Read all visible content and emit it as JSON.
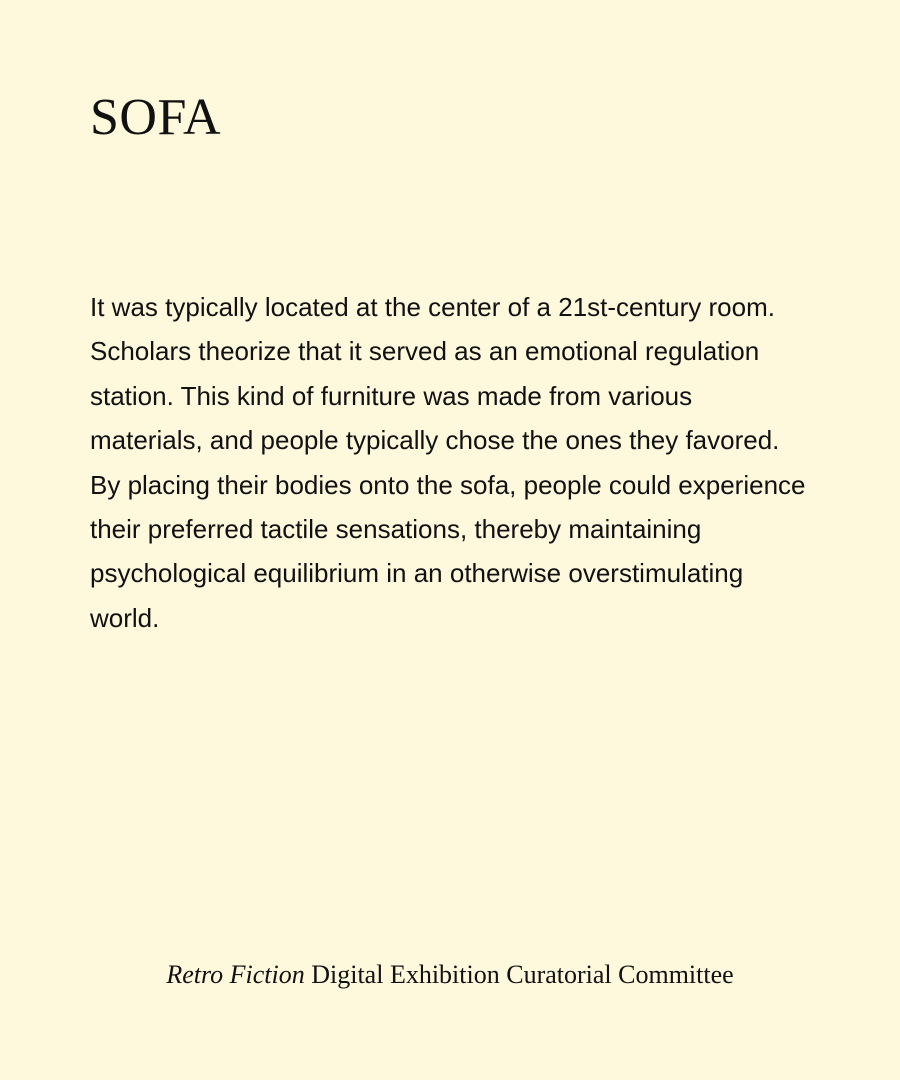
{
  "title": "SOFA",
  "description": "It was typically located at the center of a 21st-century room. Scholars theorize that it served as an emotional regulation station. This kind of furniture was made from various materials, and people typically chose the ones they favored. By placing their bodies onto the sofa, people could experience their preferred tactile sensations, thereby maintaining psychological equilibrium in an otherwise overstimulating world.",
  "footer": {
    "italic": "Retro Fiction",
    "rest": "Digital Exhibition Curatorial Committee"
  },
  "colors": {
    "background": "#fef8dc",
    "text": "#111111"
  }
}
